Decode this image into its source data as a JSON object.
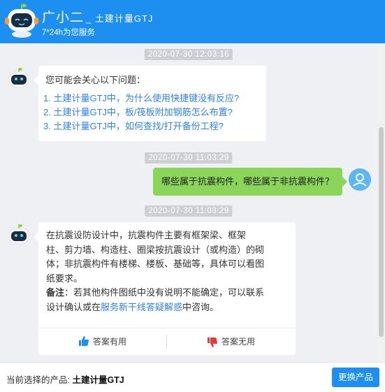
{
  "header": {
    "title": "广小二",
    "title_suffix": "_ 土建计量GTJ",
    "subtitle": "7*24h为您服务"
  },
  "messages": {
    "ts1": "2020-07-30 12:03:16",
    "intro": "您可能会关心以下问题：",
    "questions": [
      "1.  土建计量GTJ中，为什么使用快捷键没有反应?",
      "2.  土建计量GTJ中，板/筏板附加钢筋怎么布置?",
      "3.  土建计量GTJ中，如何查找/打开备份工程?"
    ],
    "ts2": "2020-07-30 11:03:29",
    "user_msg": "哪些属于抗震构件，哪些属于非抗震构件？",
    "ts3": "2020-07-30 11:03:29",
    "answer_lines": [
      "在抗震设防设计中，抗震构件主要有框架梁、框架",
      "柱、剪力墙、构造柱、圈梁按抗震设计（或构造）的砌",
      "体；非抗震构件有楼梯、楼板、基础等，具体可以看图",
      "纸要求。"
    ],
    "note_label": "备注",
    "note_line1": "：若其他构件图纸中没有说明不能确定，可以联系",
    "note_line2_pre": "设计确认或在",
    "note_link": "服务新干线答疑解惑",
    "note_line2_post": "中咨询。",
    "useful": "答案有用",
    "useless": "答案无用"
  },
  "footer": {
    "label": "当前选择的产品: ",
    "product": "土建计量GTJ",
    "switch_button": "更换产品"
  },
  "colors": {
    "brand": "#1c8ff0",
    "user_bubble": "#8bd65a",
    "link": "#2f82e0"
  },
  "icons": [
    "robot-icon",
    "user-icon",
    "thumbs-up-icon",
    "thumbs-down-icon"
  ]
}
